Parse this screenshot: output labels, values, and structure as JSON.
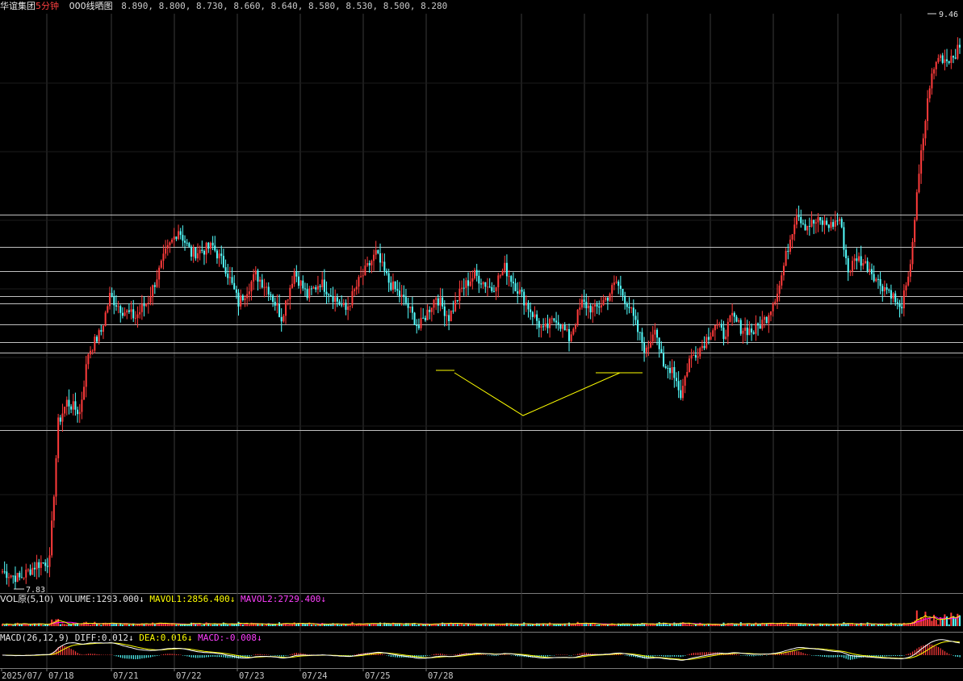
{
  "header": {
    "stock_name": "华谊集团",
    "period": "5分钟",
    "indicator": "000线晒图",
    "levels_text": "8.890, 8.800, 8.730, 8.660, 8.640, 8.580, 8.530, 8.500, 8.280"
  },
  "vol_bar": {
    "name": "VOL原(5,10)",
    "volume_label": "VOLUME:",
    "volume_value": "1293.000↓",
    "mavol1_label": "MAVOL1:",
    "mavol1_value": "2856.400↓",
    "mavol2_label": "MAVOL2:",
    "mavol2_value": "2729.400↓"
  },
  "macd_bar": {
    "name": "MACD(26,12,9)",
    "diff_label": "DIFF:",
    "diff_value": "0.012↓",
    "dea_label": "DEA:",
    "dea_value": "0.016↓",
    "macd_label": "MACD:",
    "macd_value": "-0.008↓"
  },
  "colors": {
    "up": "#ff3b3b",
    "down": "#54ffff",
    "level_line": "#c0c0c0",
    "pattern_line": "#ffff00",
    "grid": "#3a3a3a",
    "mavol1": "#ffff00",
    "mavol2": "#ff00ff",
    "diff": "#ffffff",
    "dea": "#ffff00"
  },
  "chart_data": {
    "type": "candlestick",
    "ylim": [
      7.83,
      9.46
    ],
    "max_label": "9.46",
    "min_label": "7.83",
    "levels": [
      8.89,
      8.8,
      8.73,
      8.66,
      8.64,
      8.58,
      8.53,
      8.5,
      8.28
    ],
    "x_tick_labels": [
      "2025/07/",
      "07/18",
      "07/21",
      "07/22",
      "07/23",
      "07/24",
      "07/25",
      "07/28"
    ],
    "anchors": [
      [
        0,
        7.88
      ],
      [
        8,
        7.86
      ],
      [
        16,
        7.9
      ],
      [
        22,
        7.91
      ],
      [
        26,
        8.3
      ],
      [
        30,
        8.36
      ],
      [
        36,
        8.33
      ],
      [
        40,
        8.5
      ],
      [
        46,
        8.56
      ],
      [
        50,
        8.66
      ],
      [
        56,
        8.62
      ],
      [
        62,
        8.6
      ],
      [
        68,
        8.65
      ],
      [
        76,
        8.78
      ],
      [
        82,
        8.85
      ],
      [
        88,
        8.78
      ],
      [
        98,
        8.8
      ],
      [
        104,
        8.74
      ],
      [
        110,
        8.64
      ],
      [
        118,
        8.72
      ],
      [
        124,
        8.68
      ],
      [
        130,
        8.6
      ],
      [
        136,
        8.73
      ],
      [
        142,
        8.66
      ],
      [
        148,
        8.7
      ],
      [
        154,
        8.66
      ],
      [
        160,
        8.62
      ],
      [
        166,
        8.7
      ],
      [
        174,
        8.78
      ],
      [
        180,
        8.7
      ],
      [
        188,
        8.64
      ],
      [
        194,
        8.57
      ],
      [
        202,
        8.66
      ],
      [
        208,
        8.6
      ],
      [
        214,
        8.68
      ],
      [
        220,
        8.72
      ],
      [
        228,
        8.68
      ],
      [
        234,
        8.74
      ],
      [
        240,
        8.68
      ],
      [
        246,
        8.62
      ],
      [
        252,
        8.56
      ],
      [
        258,
        8.6
      ],
      [
        264,
        8.54
      ],
      [
        270,
        8.64
      ],
      [
        276,
        8.62
      ],
      [
        282,
        8.66
      ],
      [
        286,
        8.7
      ],
      [
        292,
        8.63
      ],
      [
        296,
        8.56
      ],
      [
        300,
        8.5
      ],
      [
        304,
        8.58
      ],
      [
        308,
        8.45
      ],
      [
        312,
        8.46
      ],
      [
        316,
        8.38
      ],
      [
        320,
        8.48
      ],
      [
        326,
        8.52
      ],
      [
        332,
        8.58
      ],
      [
        336,
        8.55
      ],
      [
        340,
        8.6
      ],
      [
        344,
        8.57
      ],
      [
        350,
        8.56
      ],
      [
        356,
        8.6
      ],
      [
        362,
        8.69
      ],
      [
        366,
        8.8
      ],
      [
        370,
        8.9
      ],
      [
        374,
        8.86
      ],
      [
        380,
        8.87
      ],
      [
        386,
        8.86
      ],
      [
        390,
        8.88
      ],
      [
        394,
        8.73
      ],
      [
        398,
        8.77
      ],
      [
        404,
        8.74
      ],
      [
        408,
        8.7
      ],
      [
        414,
        8.67
      ],
      [
        418,
        8.62
      ],
      [
        422,
        8.7
      ],
      [
        428,
        9.06
      ],
      [
        432,
        9.26
      ],
      [
        436,
        9.34
      ],
      [
        440,
        9.33
      ],
      [
        446,
        9.36
      ]
    ]
  }
}
